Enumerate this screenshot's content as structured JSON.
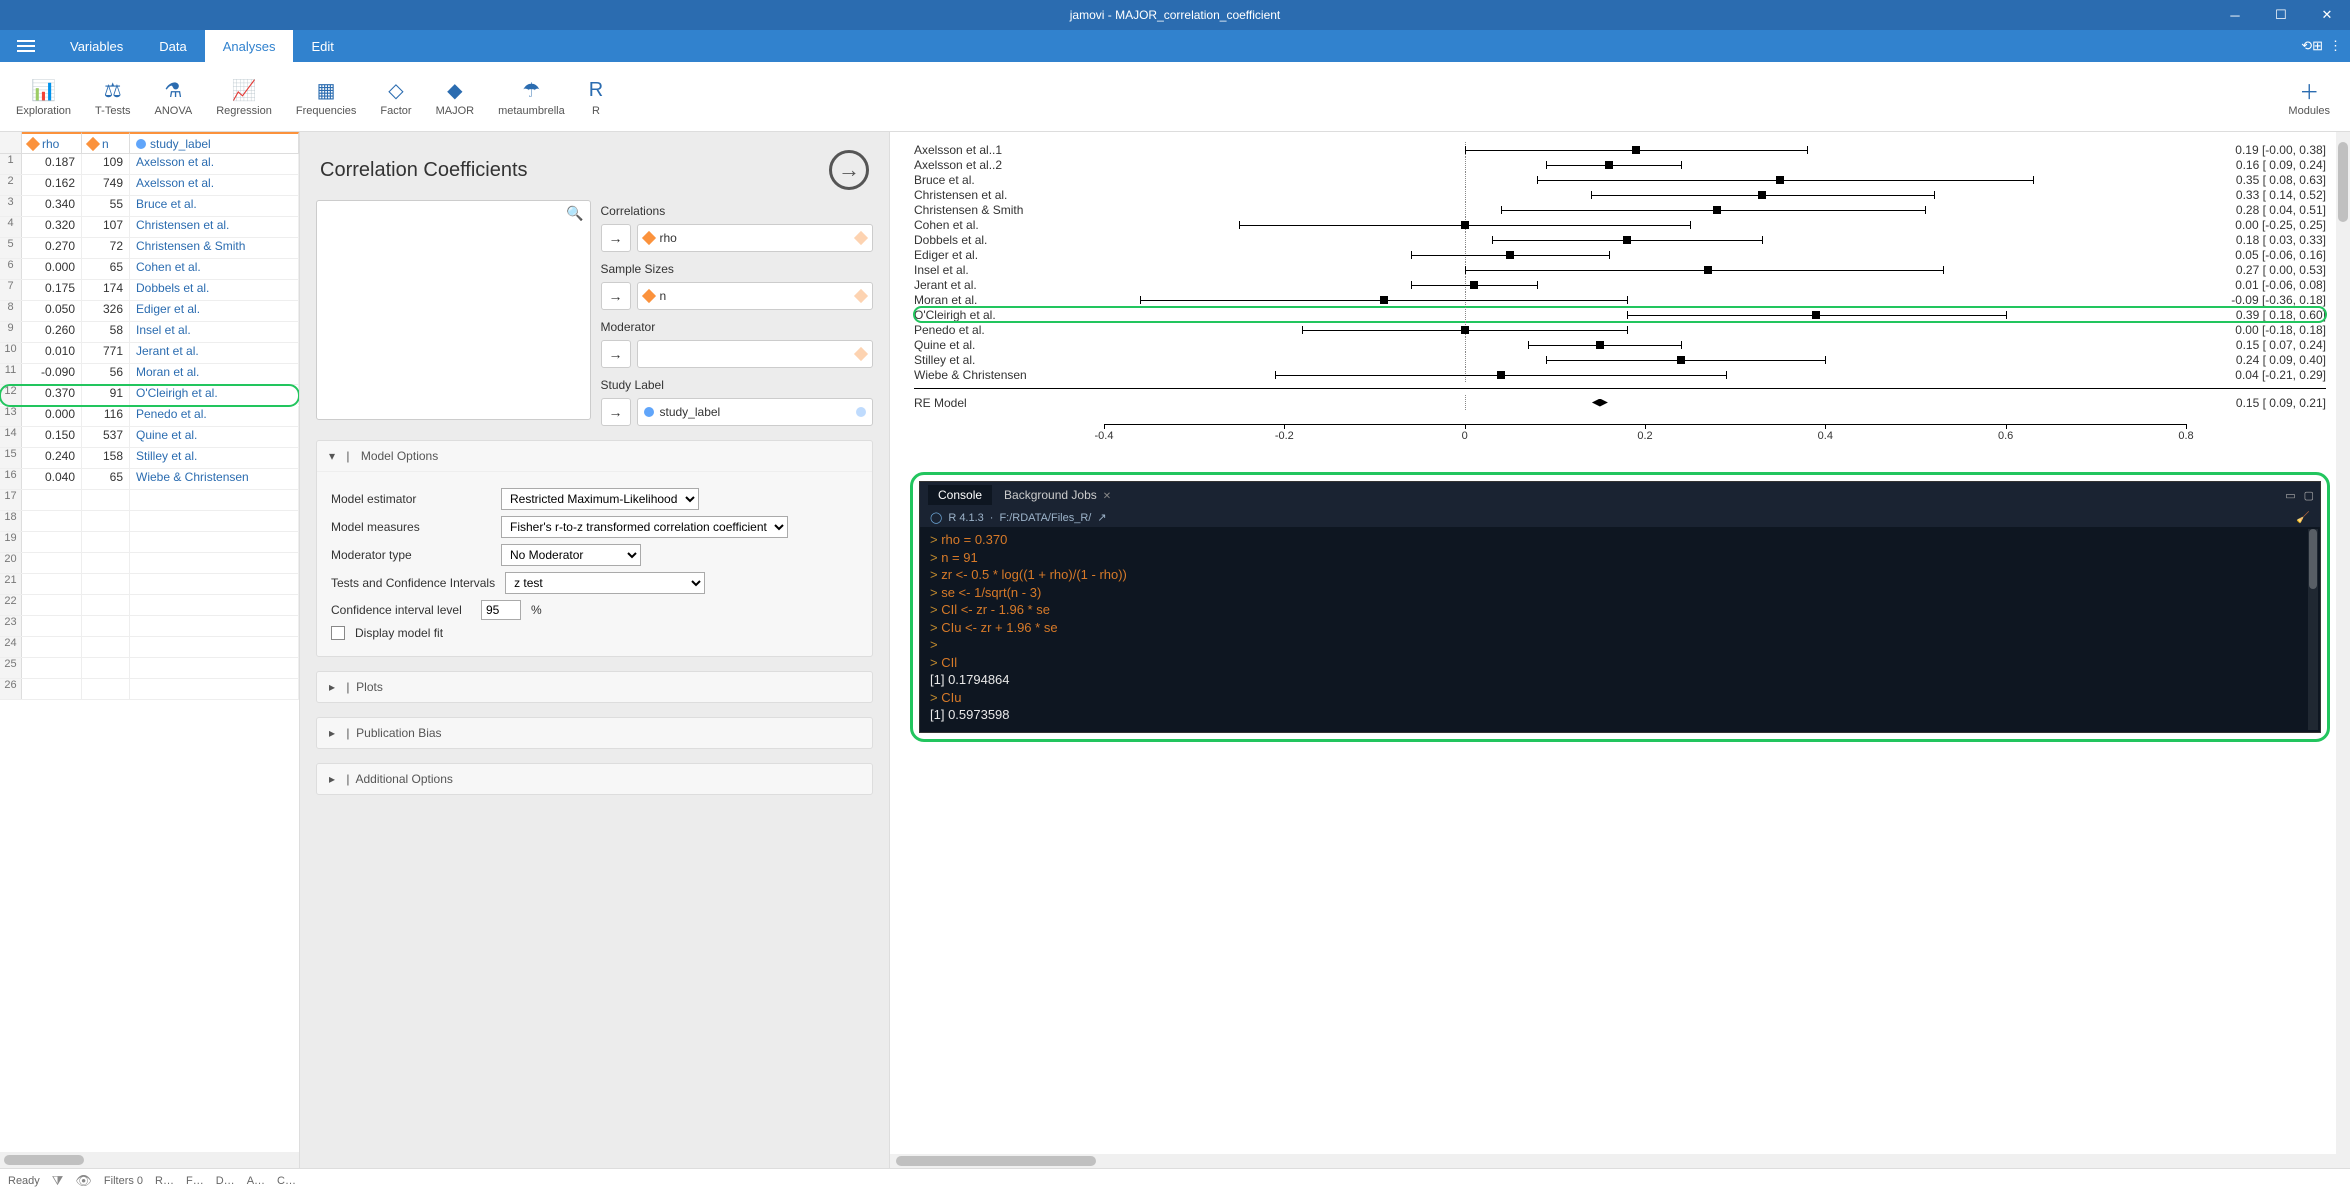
{
  "titlebar": {
    "title": "jamovi - MAJOR_correlation_coefficient"
  },
  "menu": {
    "items": [
      "Variables",
      "Data",
      "Analyses",
      "Edit"
    ],
    "active": 2
  },
  "toolbar": [
    {
      "label": "Exploration"
    },
    {
      "label": "T-Tests"
    },
    {
      "label": "ANOVA"
    },
    {
      "label": "Regression"
    },
    {
      "label": "Frequencies"
    },
    {
      "label": "Factor"
    },
    {
      "label": "MAJOR"
    },
    {
      "label": "metaumbrella"
    },
    {
      "label": "R"
    }
  ],
  "modules_label": "Modules",
  "columns": [
    "rho",
    "n",
    "study_label"
  ],
  "rows": [
    {
      "rho": "0.187",
      "n": "109",
      "label": "Axelsson et al."
    },
    {
      "rho": "0.162",
      "n": "749",
      "label": "Axelsson et al."
    },
    {
      "rho": "0.340",
      "n": "55",
      "label": "Bruce et al."
    },
    {
      "rho": "0.320",
      "n": "107",
      "label": "Christensen et al."
    },
    {
      "rho": "0.270",
      "n": "72",
      "label": "Christensen & Smith"
    },
    {
      "rho": "0.000",
      "n": "65",
      "label": "Cohen et al."
    },
    {
      "rho": "0.175",
      "n": "174",
      "label": "Dobbels et al."
    },
    {
      "rho": "0.050",
      "n": "326",
      "label": "Ediger et al."
    },
    {
      "rho": "0.260",
      "n": "58",
      "label": "Insel et al."
    },
    {
      "rho": "0.010",
      "n": "771",
      "label": "Jerant et al."
    },
    {
      "rho": "-0.090",
      "n": "56",
      "label": "Moran et al."
    },
    {
      "rho": "0.370",
      "n": "91",
      "label": "O'Cleirigh et al."
    },
    {
      "rho": "0.000",
      "n": "116",
      "label": "Penedo et al."
    },
    {
      "rho": "0.150",
      "n": "537",
      "label": "Quine et al."
    },
    {
      "rho": "0.240",
      "n": "158",
      "label": "Stilley et al."
    },
    {
      "rho": "0.040",
      "n": "65",
      "label": "Wiebe & Christensen"
    }
  ],
  "emptyRows": 10,
  "highlightRow": 11,
  "midpanel": {
    "title": "Correlation Coefficients",
    "slots": {
      "correlations": {
        "label": "Correlations",
        "value": "rho"
      },
      "sampleSizes": {
        "label": "Sample Sizes",
        "value": "n"
      },
      "moderator": {
        "label": "Moderator",
        "value": ""
      },
      "studyLabel": {
        "label": "Study Label",
        "value": "study_label"
      }
    },
    "modelOptions": {
      "header": "Model Options",
      "estimator": {
        "label": "Model estimator",
        "value": "Restricted Maximum-Likelihood"
      },
      "measures": {
        "label": "Model measures",
        "value": "Fisher's r-to-z transformed correlation coefficient"
      },
      "modtype": {
        "label": "Moderator type",
        "value": "No Moderator"
      },
      "tests": {
        "label": "Tests and Confidence Intervals",
        "value": "z test"
      },
      "cilevel": {
        "label": "Confidence interval level",
        "value": "95",
        "suffix": "%"
      },
      "displayfit": "Display model fit"
    },
    "sections": [
      "Plots",
      "Publication Bias",
      "Additional Options"
    ]
  },
  "chart_data": {
    "type": "forest",
    "xlim": [
      -0.4,
      0.8
    ],
    "ticks": [
      -0.4,
      -0.2,
      0,
      0.2,
      0.4,
      0.6,
      0.8
    ],
    "studies": [
      {
        "label": "Axelsson et al..1",
        "est": 0.19,
        "lo": -0.0,
        "hi": 0.38,
        "text": "0.19 [-0.00, 0.38]"
      },
      {
        "label": "Axelsson et al..2",
        "est": 0.16,
        "lo": 0.09,
        "hi": 0.24,
        "text": "0.16 [ 0.09, 0.24]"
      },
      {
        "label": "Bruce et al.",
        "est": 0.35,
        "lo": 0.08,
        "hi": 0.63,
        "text": "0.35 [ 0.08, 0.63]"
      },
      {
        "label": "Christensen et al.",
        "est": 0.33,
        "lo": 0.14,
        "hi": 0.52,
        "text": "0.33 [ 0.14, 0.52]"
      },
      {
        "label": "Christensen & Smith",
        "est": 0.28,
        "lo": 0.04,
        "hi": 0.51,
        "text": "0.28 [ 0.04, 0.51]"
      },
      {
        "label": "Cohen et al.",
        "est": 0.0,
        "lo": -0.25,
        "hi": 0.25,
        "text": "0.00 [-0.25, 0.25]"
      },
      {
        "label": "Dobbels et al.",
        "est": 0.18,
        "lo": 0.03,
        "hi": 0.33,
        "text": "0.18 [ 0.03, 0.33]"
      },
      {
        "label": "Ediger et al.",
        "est": 0.05,
        "lo": -0.06,
        "hi": 0.16,
        "text": "0.05 [-0.06, 0.16]"
      },
      {
        "label": "Insel et al.",
        "est": 0.27,
        "lo": 0.0,
        "hi": 0.53,
        "text": "0.27 [ 0.00, 0.53]"
      },
      {
        "label": "Jerant et al.",
        "est": 0.01,
        "lo": -0.06,
        "hi": 0.08,
        "text": "0.01 [-0.06, 0.08]"
      },
      {
        "label": "Moran et al.",
        "est": -0.09,
        "lo": -0.36,
        "hi": 0.18,
        "text": "-0.09 [-0.36, 0.18]"
      },
      {
        "label": "O'Cleirigh et al.",
        "est": 0.39,
        "lo": 0.18,
        "hi": 0.6,
        "text": "0.39 [ 0.18, 0.60]"
      },
      {
        "label": "Penedo et al.",
        "est": 0.0,
        "lo": -0.18,
        "hi": 0.18,
        "text": "0.00 [-0.18, 0.18]"
      },
      {
        "label": "Quine et al.",
        "est": 0.15,
        "lo": 0.07,
        "hi": 0.24,
        "text": "0.15 [ 0.07, 0.24]"
      },
      {
        "label": "Stilley et al.",
        "est": 0.24,
        "lo": 0.09,
        "hi": 0.4,
        "text": "0.24 [ 0.09, 0.40]"
      },
      {
        "label": "Wiebe & Christensen",
        "est": 0.04,
        "lo": -0.21,
        "hi": 0.29,
        "text": "0.04 [-0.21, 0.29]"
      }
    ],
    "highlight": 11,
    "summary": {
      "label": "RE Model",
      "est": 0.15,
      "lo": 0.09,
      "hi": 0.21,
      "text": "0.15 [ 0.09, 0.21]"
    }
  },
  "rconsole": {
    "tabs": [
      "Console",
      "Background Jobs"
    ],
    "version": "R 4.1.3",
    "path": "F:/RDATA/Files_R/",
    "lines": [
      {
        "t": "in",
        "s": "rho = 0.370"
      },
      {
        "t": "in",
        "s": "n = 91"
      },
      {
        "t": "in",
        "s": "zr <- 0.5 * log((1 + rho)/(1 - rho))"
      },
      {
        "t": "in",
        "s": "se <- 1/sqrt(n - 3)"
      },
      {
        "t": "in",
        "s": "CIl <- zr - 1.96 * se"
      },
      {
        "t": "in",
        "s": "CIu <- zr + 1.96 * se"
      },
      {
        "t": "in",
        "s": ""
      },
      {
        "t": "in",
        "s": "CIl"
      },
      {
        "t": "out",
        "s": "[1] 0.1794864"
      },
      {
        "t": "in",
        "s": "CIu"
      },
      {
        "t": "out",
        "s": "[1] 0.5973598"
      }
    ]
  },
  "status": {
    "ready": "Ready",
    "filters": "Filters 0",
    "abbrev": [
      "R…",
      "F…",
      "D…",
      "A…",
      "C…"
    ]
  }
}
